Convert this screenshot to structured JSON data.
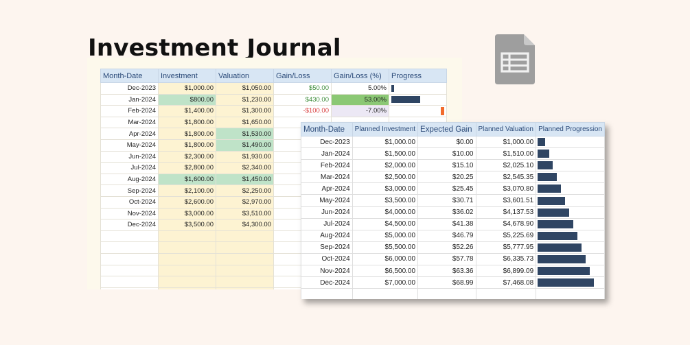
{
  "title": "Investment Journal",
  "icon": "google-sheets-icon",
  "journal": {
    "headers": [
      "Month-Date",
      "Investment",
      "Valuation",
      "Gain/Loss",
      "Gain/Loss (%)",
      "Progress"
    ],
    "rows": [
      {
        "date": "Dec-2023",
        "investment": "$1,000.00",
        "valuation": "$1,050.00",
        "gain": "$50.00",
        "pct": "5.00%",
        "progress": 0.05
      },
      {
        "date": "Jan-2024",
        "investment": "$800.00",
        "valuation": "$1,230.00",
        "gain": "$430.00",
        "pct": "53.00%",
        "progress": 0.53
      },
      {
        "date": "Feb-2024",
        "investment": "$1,400.00",
        "valuation": "$1,300.00",
        "gain": "-$100.00",
        "pct": "-7.00%",
        "progress": -0.07
      },
      {
        "date": "Mar-2024",
        "investment": "$1,800.00",
        "valuation": "$1,650.00",
        "gain": "",
        "pct": "",
        "progress": null
      },
      {
        "date": "Apr-2024",
        "investment": "$1,800.00",
        "valuation": "$1,530.00",
        "gain": "",
        "pct": "",
        "progress": null
      },
      {
        "date": "May-2024",
        "investment": "$1,800.00",
        "valuation": "$1,490.00",
        "gain": "",
        "pct": "",
        "progress": null
      },
      {
        "date": "Jun-2024",
        "investment": "$2,300.00",
        "valuation": "$1,930.00",
        "gain": "",
        "pct": "",
        "progress": null
      },
      {
        "date": "Jul-2024",
        "investment": "$2,800.00",
        "valuation": "$2,340.00",
        "gain": "",
        "pct": "",
        "progress": null
      },
      {
        "date": "Aug-2024",
        "investment": "$1,600.00",
        "valuation": "$1,450.00",
        "gain": "",
        "pct": "",
        "progress": null
      },
      {
        "date": "Sep-2024",
        "investment": "$2,100.00",
        "valuation": "$2,250.00",
        "gain": "",
        "pct": "",
        "progress": null
      },
      {
        "date": "Oct-2024",
        "investment": "$2,600.00",
        "valuation": "$2,970.00",
        "gain": "",
        "pct": "",
        "progress": null
      },
      {
        "date": "Nov-2024",
        "investment": "$3,000.00",
        "valuation": "$3,510.00",
        "gain": "",
        "pct": "",
        "progress": null
      },
      {
        "date": "Dec-2024",
        "investment": "$3,500.00",
        "valuation": "$4,300.00",
        "gain": "",
        "pct": "",
        "progress": null
      }
    ],
    "highlight_investment": [
      1,
      8
    ],
    "highlight_valuation": [
      4,
      5,
      8
    ],
    "highlight_gain_pct": [
      1
    ]
  },
  "plan": {
    "headers": [
      "Month-Date",
      "Planned Investment",
      "Expected Gain",
      "Planned Valuation",
      "Planned Progression"
    ],
    "rows": [
      {
        "date": "Dec-2023",
        "investment": "$1,000.00",
        "gain": "$0.00",
        "valuation": "$1,000.00"
      },
      {
        "date": "Jan-2024",
        "investment": "$1,500.00",
        "gain": "$10.00",
        "valuation": "$1,510.00"
      },
      {
        "date": "Feb-2024",
        "investment": "$2,000.00",
        "gain": "$15.10",
        "valuation": "$2,025.10"
      },
      {
        "date": "Mar-2024",
        "investment": "$2,500.00",
        "gain": "$20.25",
        "valuation": "$2,545.35"
      },
      {
        "date": "Apr-2024",
        "investment": "$3,000.00",
        "gain": "$25.45",
        "valuation": "$3,070.80"
      },
      {
        "date": "May-2024",
        "investment": "$3,500.00",
        "gain": "$30.71",
        "valuation": "$3,601.51"
      },
      {
        "date": "Jun-2024",
        "investment": "$4,000.00",
        "gain": "$36.02",
        "valuation": "$4,137.53"
      },
      {
        "date": "Jul-2024",
        "investment": "$4,500.00",
        "gain": "$41.38",
        "valuation": "$4,678.90"
      },
      {
        "date": "Aug-2024",
        "investment": "$5,000.00",
        "gain": "$46.79",
        "valuation": "$5,225.69"
      },
      {
        "date": "Sep-2024",
        "investment": "$5,500.00",
        "gain": "$52.26",
        "valuation": "$5,777.95"
      },
      {
        "date": "Oct-2024",
        "investment": "$6,000.00",
        "gain": "$57.78",
        "valuation": "$6,335.73"
      },
      {
        "date": "Nov-2024",
        "investment": "$6,500.00",
        "gain": "$63.36",
        "valuation": "$6,899.09"
      },
      {
        "date": "Dec-2024",
        "investment": "$7,000.00",
        "gain": "$68.99",
        "valuation": "$7,468.08"
      }
    ]
  },
  "colors": {
    "accent_bar": "#2f4563",
    "header_bg": "#d8e6f4",
    "positive": "#3e8d3a",
    "negative": "#d83b3b",
    "highlight_green": "#bfe3c8",
    "negative_bar": "#f26b2c"
  }
}
